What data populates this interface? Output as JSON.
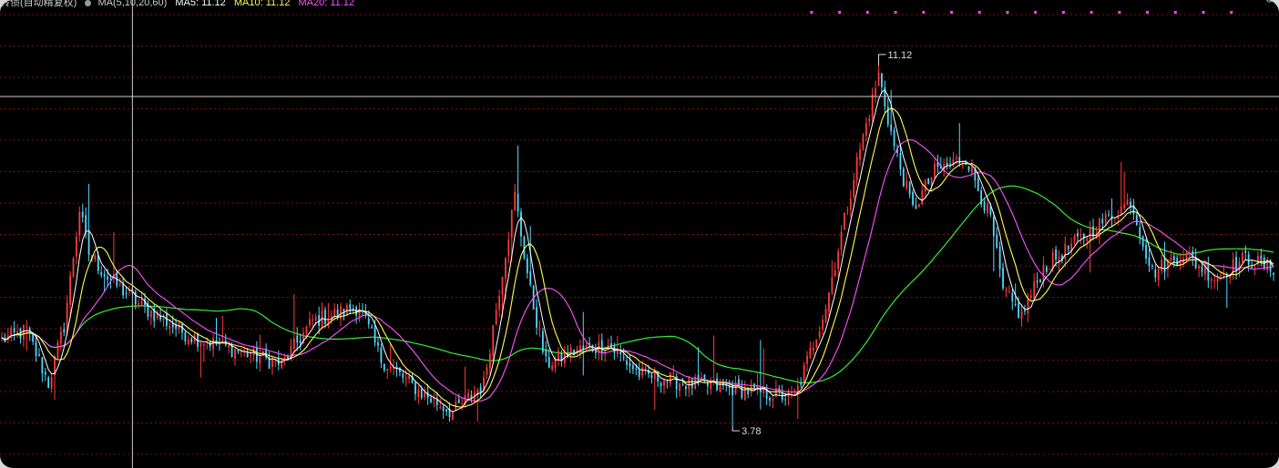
{
  "header": {
    "title": "转债(自动精复权)",
    "indicator": "MA(5,10,20,60)",
    "ma5_label": "MA5: 11.12",
    "ma10_label": "MA10: 11.12",
    "ma20_label": "MA20: 11.12",
    "corner_icon": "settings-icon"
  },
  "colors": {
    "background": "#000000",
    "grid": "#7a1414",
    "up_candle": "#ff3a3a",
    "down_candle": "#54d8ff",
    "ma5": "#ffffff",
    "ma10": "#ffff55",
    "ma20": "#ff55ff",
    "ma60": "#33ee33",
    "crosshair": "#cccccc",
    "marker": "#ff44ff"
  },
  "chart_data": {
    "type": "candlestick",
    "y_unit": "price",
    "ylim": [
      3.0,
      12.4
    ],
    "grid": "horizontal dashed",
    "annotations": [
      {
        "label": "11.12",
        "type": "max"
      },
      {
        "label": "3.78",
        "type": "min"
      }
    ],
    "crosshair": {
      "bar_index": 42,
      "price": 10.55
    },
    "series": [
      {
        "name": "MA5",
        "key": "ma5"
      },
      {
        "name": "MA10",
        "key": "ma10"
      },
      {
        "name": "MA20",
        "key": "ma20"
      },
      {
        "name": "MA60",
        "key": "ma60"
      }
    ],
    "anchors": [
      [
        0,
        5.5
      ],
      [
        8,
        5.7
      ],
      [
        15,
        4.6
      ],
      [
        20,
        5.8
      ],
      [
        25,
        8.2
      ],
      [
        28,
        7.3
      ],
      [
        34,
        6.8
      ],
      [
        45,
        6.2
      ],
      [
        60,
        5.6
      ],
      [
        75,
        5.3
      ],
      [
        90,
        5.0
      ],
      [
        100,
        5.9
      ],
      [
        115,
        6.2
      ],
      [
        122,
        5.1
      ],
      [
        135,
        4.4
      ],
      [
        145,
        4.0
      ],
      [
        155,
        4.6
      ],
      [
        165,
        8.5
      ],
      [
        170,
        6.5
      ],
      [
        175,
        5.0
      ],
      [
        185,
        5.3
      ],
      [
        195,
        5.4
      ],
      [
        205,
        4.8
      ],
      [
        220,
        4.6
      ],
      [
        235,
        4.5
      ],
      [
        255,
        4.3
      ],
      [
        265,
        6.2
      ],
      [
        275,
        9.2
      ],
      [
        282,
        11.0
      ],
      [
        287,
        9.5
      ],
      [
        293,
        8.2
      ],
      [
        300,
        9.0
      ],
      [
        310,
        9.3
      ],
      [
        318,
        8.0
      ],
      [
        322,
        6.5
      ],
      [
        328,
        6.0
      ],
      [
        335,
        7.0
      ],
      [
        345,
        7.5
      ],
      [
        355,
        8.0
      ],
      [
        363,
        8.4
      ],
      [
        370,
        6.9
      ],
      [
        380,
        7.3
      ],
      [
        390,
        6.8
      ],
      [
        400,
        7.2
      ],
      [
        408,
        7.0
      ]
    ],
    "bars": 410
  }
}
